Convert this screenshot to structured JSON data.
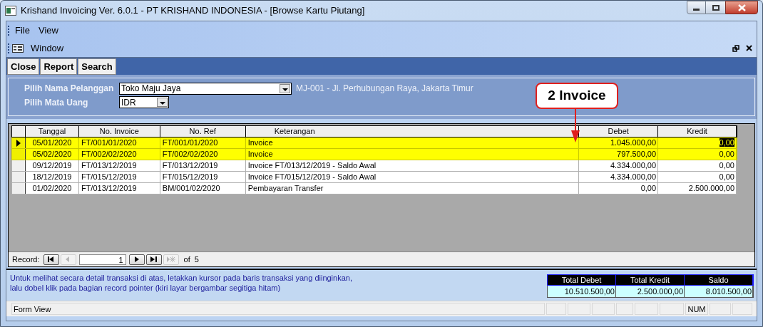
{
  "window": {
    "title": "Krishand Invoicing Ver. 6.0.1 - PT KRISHAND INDONESIA - [Browse Kartu Piutang]"
  },
  "menu": [
    {
      "label": "File"
    },
    {
      "label": "View"
    }
  ],
  "menu2": [
    {
      "label": "Window"
    }
  ],
  "toolbar": [
    {
      "label": "Close"
    },
    {
      "label": "Report"
    },
    {
      "label": "Search"
    }
  ],
  "filter": {
    "customer_label": "Pilih Nama Pelanggan",
    "customer": "Toko Maju Jaya",
    "customer_info": "MJ-001 - Jl. Perhubungan Raya, Jakarta Timur",
    "currency_label": "Pilih Mata Uang",
    "currency": "IDR"
  },
  "callout": {
    "text": "2 Invoice"
  },
  "table": {
    "columns": [
      "Tanggal",
      "No. Invoice",
      "No. Ref",
      "Keterangan",
      "Debet",
      "Kredit"
    ],
    "rows": [
      {
        "current": true,
        "highlighted": true,
        "cells": [
          "05/01/2020",
          "FT/001/01/2020",
          "FT/001/01/2020",
          "Invoice",
          "1.045.000,00",
          "0,00"
        ]
      },
      {
        "current": false,
        "highlighted": true,
        "cells": [
          "05/02/2020",
          "FT/002/02/2020",
          "FT/002/02/2020",
          "Invoice",
          "797.500,00",
          "0,00"
        ]
      },
      {
        "current": false,
        "highlighted": false,
        "cells": [
          "09/12/2019",
          "FT/013/12/2019",
          "FT/013/12/2019",
          "Invoice FT/013/12/2019 - Saldo Awal",
          "4.334.000,00",
          "0,00"
        ]
      },
      {
        "current": false,
        "highlighted": false,
        "cells": [
          "18/12/2019",
          "FT/015/12/2019",
          "FT/015/12/2019",
          "Invoice FT/015/12/2019 - Saldo Awal",
          "4.334.000,00",
          "0,00"
        ]
      },
      {
        "current": false,
        "highlighted": false,
        "cells": [
          "01/02/2020",
          "FT/013/12/2019",
          "BM/001/02/2020",
          "Pembayaran Transfer",
          "0,00",
          "2.500.000,00"
        ]
      }
    ]
  },
  "record_nav": {
    "label": "Record:",
    "value": "1",
    "of": "of",
    "total": "5",
    "buttons": [
      {
        "kind": "first",
        "disabled": false
      },
      {
        "kind": "prev",
        "disabled": true
      },
      {
        "kind": "next",
        "disabled": false
      },
      {
        "kind": "last",
        "disabled": false
      },
      {
        "kind": "new",
        "disabled": true
      }
    ]
  },
  "hint": "Untuk melihat secara detail transaksi di atas, letakkan kursor pada baris transaksi yang diinginkan,\nlalu dobel klik pada bagian record pointer (kiri layar bergambar segitiga hitam)",
  "totals": [
    {
      "label": "Total Debet",
      "value": "10.510.500,00"
    },
    {
      "label": "Total Kredit",
      "value": "2.500.000,00"
    },
    {
      "label": "Saldo",
      "value": "8.010.500,00"
    }
  ],
  "status_bar": {
    "text": "Form View",
    "indicators": [
      "NUM"
    ]
  }
}
